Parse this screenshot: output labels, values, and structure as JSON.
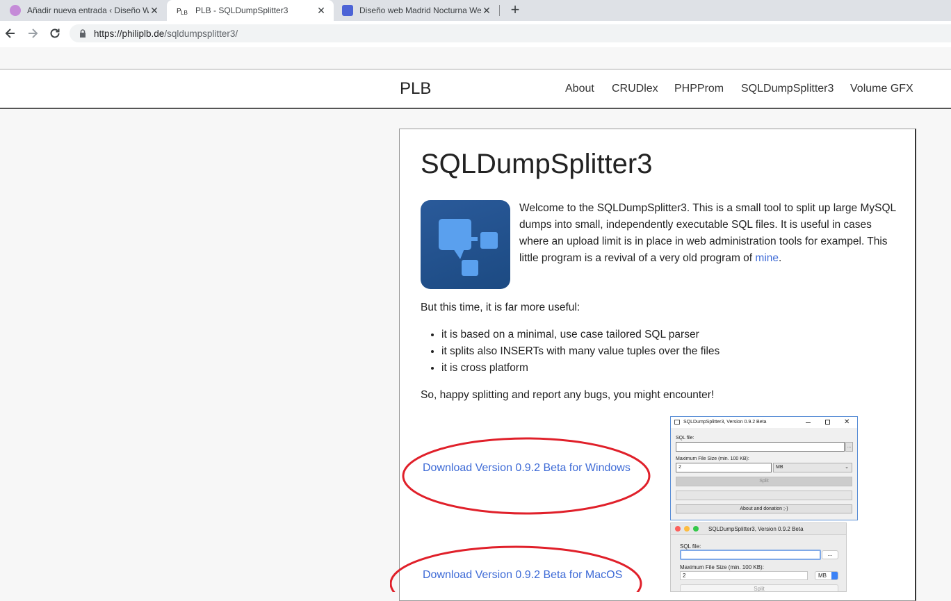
{
  "browser": {
    "tabs": [
      {
        "title": "Añadir nueva entrada ‹ Diseño W",
        "icon": "owl-icon",
        "active": false
      },
      {
        "title": "PLB - SQLDumpSplitter3",
        "icon": "plb-icon",
        "active": true
      },
      {
        "title": "Diseño web Madrid Nocturna We",
        "icon": "site-icon",
        "active": false
      }
    ],
    "close_glyph": "✕",
    "new_tab_glyph": "+",
    "url_host": "https://philiplb.de",
    "url_path": "/sqldumpsplitter3/"
  },
  "site": {
    "brand": "PLB",
    "nav": [
      "About",
      "CRUDlex",
      "PHPProm",
      "SQLDumpSplitter3",
      "Volume GFX"
    ]
  },
  "content": {
    "title": "SQLDumpSplitter3",
    "intro_text": "Welcome to the SQLDumpSplitter3. This is a small tool to split up large MySQL dumps into small, independently executable SQL files. It is useful in cases where an upload limit is in place in web administration tools for exampel. This little program is a revival of a very old program of ",
    "intro_link": "mine",
    "intro_end": ".",
    "but_text": "But this time, it is far more useful:",
    "bullets": [
      "it is based on a minimal, use case tailored SQL parser",
      "it splits also INSERTs with many value tuples over the files",
      "it is cross platform"
    ],
    "happy_text": "So, happy splitting and report any bugs, you might encounter!",
    "download_windows": "Download Version 0.9.2 Beta for Windows",
    "download_macos": "Download Version 0.9.2 Beta for MacOS"
  },
  "screenshot_windows": {
    "title": "SQLDumpSplitter3, Version 0.9.2 Beta",
    "sql_file_label": "SQL file:",
    "browse": "...",
    "max_size_label": "Maximum File Size (min. 100 KB):",
    "size_value": "2",
    "unit": "MB",
    "split": "Split",
    "about": "About and donation ;-)"
  },
  "screenshot_mac": {
    "title": "SQLDumpSplitter3, Version 0.9.2 Beta",
    "sql_file_label": "SQL file:",
    "browse": "...",
    "max_size_label": "Maximum File Size (min. 100 KB):",
    "size_value": "2",
    "unit": "MB",
    "split": "Split"
  },
  "colors": {
    "link": "#3d6ad6",
    "annotation": "#e0202a",
    "icon_bg": "#1f4f8a",
    "icon_shapes": "#5aa0ee"
  }
}
